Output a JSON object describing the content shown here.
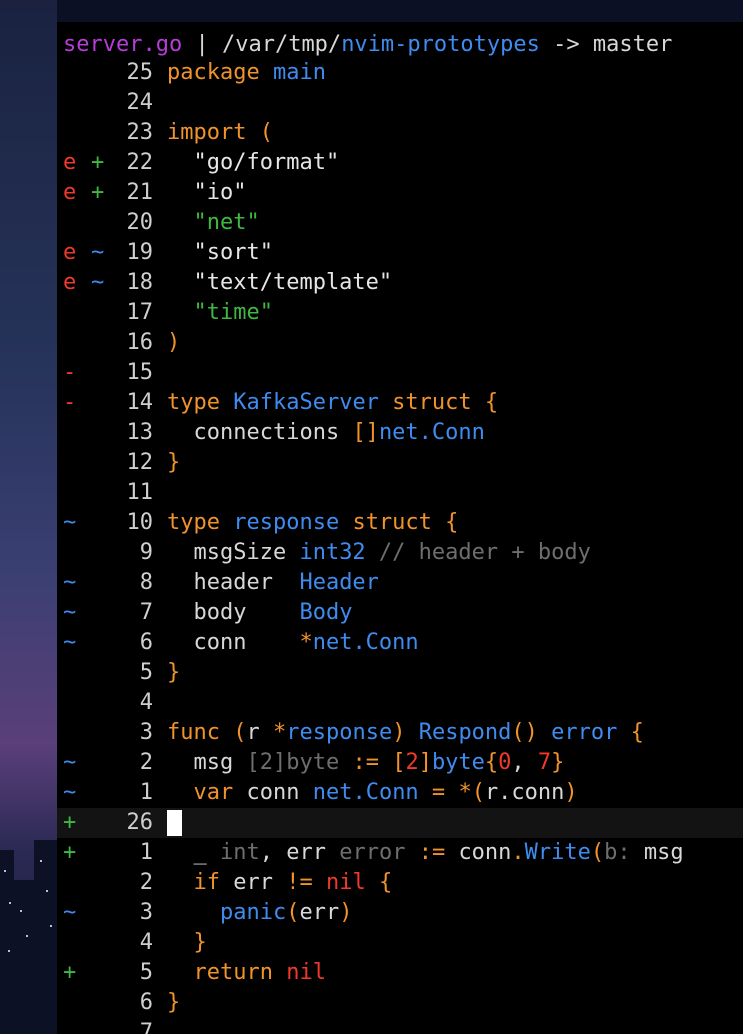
{
  "statusline": {
    "filename": "server.go",
    "separator": " | ",
    "path_prefix": "/var/tmp/",
    "path_dir": "nvim-prototypes",
    "arrow": " -> ",
    "branch": "master"
  },
  "lines": [
    {
      "sign1": "",
      "sign1_color": "",
      "sign2": "",
      "sign2_color": "",
      "lnum": "25",
      "segments": [
        {
          "text": "package ",
          "cls": "k"
        },
        {
          "text": "main",
          "cls": "t"
        }
      ]
    },
    {
      "sign1": "",
      "sign1_color": "",
      "sign2": "",
      "sign2_color": "",
      "lnum": "24",
      "segments": []
    },
    {
      "sign1": "",
      "sign1_color": "",
      "sign2": "",
      "sign2_color": "",
      "lnum": "23",
      "segments": [
        {
          "text": "import (",
          "cls": "k"
        }
      ]
    },
    {
      "sign1": "e",
      "sign1_color": "col-e",
      "sign2": "+",
      "sign2_color": "col-plus",
      "lnum": "22",
      "segments": [
        {
          "text": "  \"go/format\"",
          "cls": "s"
        }
      ]
    },
    {
      "sign1": "e",
      "sign1_color": "col-e",
      "sign2": "+",
      "sign2_color": "col-plus",
      "lnum": "21",
      "segments": [
        {
          "text": "  \"io\"",
          "cls": "s"
        }
      ]
    },
    {
      "sign1": "",
      "sign1_color": "",
      "sign2": "",
      "sign2_color": "",
      "lnum": "20",
      "segments": [
        {
          "text": "  \"net\"",
          "cls": "sg"
        }
      ]
    },
    {
      "sign1": "e",
      "sign1_color": "col-e",
      "sign2": "~",
      "sign2_color": "col-tilde",
      "lnum": "19",
      "segments": [
        {
          "text": "  \"sort\"",
          "cls": "s"
        }
      ]
    },
    {
      "sign1": "e",
      "sign1_color": "col-e",
      "sign2": "~",
      "sign2_color": "col-tilde",
      "lnum": "18",
      "segments": [
        {
          "text": "  \"text/template\"",
          "cls": "s"
        }
      ]
    },
    {
      "sign1": "",
      "sign1_color": "",
      "sign2": "",
      "sign2_color": "",
      "lnum": "17",
      "segments": [
        {
          "text": "  \"time\"",
          "cls": "sg"
        }
      ]
    },
    {
      "sign1": "",
      "sign1_color": "",
      "sign2": "",
      "sign2_color": "",
      "lnum": "16",
      "segments": [
        {
          "text": ")",
          "cls": "k"
        }
      ]
    },
    {
      "sign1": "-",
      "sign1_color": "col-minus",
      "sign2": "",
      "sign2_color": "",
      "lnum": "15",
      "segments": []
    },
    {
      "sign1": "-",
      "sign1_color": "col-minus",
      "sign2": "",
      "sign2_color": "",
      "lnum": "14",
      "segments": [
        {
          "text": "type ",
          "cls": "k"
        },
        {
          "text": "KafkaServer",
          "cls": "t"
        },
        {
          "text": " struct {",
          "cls": "k"
        }
      ]
    },
    {
      "sign1": "",
      "sign1_color": "",
      "sign2": "",
      "sign2_color": "",
      "lnum": "13",
      "segments": [
        {
          "text": "  connections ",
          "cls": "w"
        },
        {
          "text": "[]",
          "cls": "p"
        },
        {
          "text": "net.Conn",
          "cls": "t"
        }
      ]
    },
    {
      "sign1": "",
      "sign1_color": "",
      "sign2": "",
      "sign2_color": "",
      "lnum": "12",
      "segments": [
        {
          "text": "}",
          "cls": "k"
        }
      ]
    },
    {
      "sign1": "",
      "sign1_color": "",
      "sign2": "",
      "sign2_color": "",
      "lnum": "11",
      "segments": []
    },
    {
      "sign1": "~",
      "sign1_color": "col-tilde",
      "sign2": "",
      "sign2_color": "",
      "lnum": "10",
      "segments": [
        {
          "text": "type ",
          "cls": "k"
        },
        {
          "text": "response",
          "cls": "t"
        },
        {
          "text": " struct {",
          "cls": "k"
        }
      ]
    },
    {
      "sign1": "",
      "sign1_color": "",
      "sign2": "",
      "sign2_color": "",
      "lnum": "9",
      "segments": [
        {
          "text": "  msgSize ",
          "cls": "w"
        },
        {
          "text": "int32",
          "cls": "t"
        },
        {
          "text": " // header + body",
          "cls": "c"
        }
      ]
    },
    {
      "sign1": "~",
      "sign1_color": "col-tilde",
      "sign2": "",
      "sign2_color": "",
      "lnum": "8",
      "segments": [
        {
          "text": "  header  ",
          "cls": "w"
        },
        {
          "text": "Header",
          "cls": "t"
        }
      ]
    },
    {
      "sign1": "~",
      "sign1_color": "col-tilde",
      "sign2": "",
      "sign2_color": "",
      "lnum": "7",
      "segments": [
        {
          "text": "  body    ",
          "cls": "w"
        },
        {
          "text": "Body",
          "cls": "t"
        }
      ]
    },
    {
      "sign1": "~",
      "sign1_color": "col-tilde",
      "sign2": "",
      "sign2_color": "",
      "lnum": "6",
      "segments": [
        {
          "text": "  conn    ",
          "cls": "w"
        },
        {
          "text": "*",
          "cls": "p"
        },
        {
          "text": "net.Conn",
          "cls": "t"
        }
      ]
    },
    {
      "sign1": "",
      "sign1_color": "",
      "sign2": "",
      "sign2_color": "",
      "lnum": "5",
      "segments": [
        {
          "text": "}",
          "cls": "k"
        }
      ]
    },
    {
      "sign1": "",
      "sign1_color": "",
      "sign2": "",
      "sign2_color": "",
      "lnum": "4",
      "segments": []
    },
    {
      "sign1": "",
      "sign1_color": "",
      "sign2": "",
      "sign2_color": "",
      "lnum": "3",
      "segments": [
        {
          "text": "func (",
          "cls": "k"
        },
        {
          "text": "r ",
          "cls": "w"
        },
        {
          "text": "*",
          "cls": "p"
        },
        {
          "text": "response",
          "cls": "t"
        },
        {
          "text": ") ",
          "cls": "k"
        },
        {
          "text": "Respond",
          "cls": "t"
        },
        {
          "text": "() ",
          "cls": "k"
        },
        {
          "text": "error",
          "cls": "t"
        },
        {
          "text": " {",
          "cls": "k"
        }
      ]
    },
    {
      "sign1": "~",
      "sign1_color": "col-tilde",
      "sign2": "",
      "sign2_color": "",
      "lnum": "2",
      "segments": [
        {
          "text": "  msg ",
          "cls": "w"
        },
        {
          "text": "[2]byte",
          "cls": "g"
        },
        {
          "text": " := ",
          "cls": "k"
        },
        {
          "text": "[",
          "cls": "p"
        },
        {
          "text": "2",
          "cls": "n"
        },
        {
          "text": "]",
          "cls": "p"
        },
        {
          "text": "byte",
          "cls": "t"
        },
        {
          "text": "{",
          "cls": "p"
        },
        {
          "text": "0",
          "cls": "n"
        },
        {
          "text": ", ",
          "cls": "w"
        },
        {
          "text": "7",
          "cls": "n"
        },
        {
          "text": "}",
          "cls": "p"
        }
      ]
    },
    {
      "sign1": "~",
      "sign1_color": "col-tilde",
      "sign2": "",
      "sign2_color": "",
      "lnum": "1",
      "segments": [
        {
          "text": "  var ",
          "cls": "k"
        },
        {
          "text": "conn ",
          "cls": "w"
        },
        {
          "text": "net.Conn",
          "cls": "t"
        },
        {
          "text": " = ",
          "cls": "k"
        },
        {
          "text": "*",
          "cls": "p"
        },
        {
          "text": "(",
          "cls": "k"
        },
        {
          "text": "r.conn",
          "cls": "w"
        },
        {
          "text": ")",
          "cls": "k"
        }
      ]
    },
    {
      "sign1": "+",
      "sign1_color": "col-plus",
      "sign2": "",
      "sign2_color": "",
      "lnum": "26",
      "cursor": true,
      "segments": []
    },
    {
      "sign1": "+",
      "sign1_color": "col-plus",
      "sign2": "",
      "sign2_color": "",
      "lnum": "1",
      "segments": [
        {
          "text": "  _ ",
          "cls": "w"
        },
        {
          "text": "int",
          "cls": "g"
        },
        {
          "text": ", ",
          "cls": "w"
        },
        {
          "text": "err ",
          "cls": "w"
        },
        {
          "text": "error",
          "cls": "g"
        },
        {
          "text": " := ",
          "cls": "k"
        },
        {
          "text": "conn",
          "cls": "w"
        },
        {
          "text": ".",
          "cls": "k"
        },
        {
          "text": "Write",
          "cls": "t"
        },
        {
          "text": "(",
          "cls": "k"
        },
        {
          "text": "b: ",
          "cls": "g"
        },
        {
          "text": "msg",
          "cls": "w"
        }
      ]
    },
    {
      "sign1": "",
      "sign1_color": "",
      "sign2": "",
      "sign2_color": "",
      "lnum": "2",
      "segments": [
        {
          "text": "  if ",
          "cls": "k"
        },
        {
          "text": "err ",
          "cls": "w"
        },
        {
          "text": "!= ",
          "cls": "k"
        },
        {
          "text": "nil",
          "cls": "n"
        },
        {
          "text": " {",
          "cls": "k"
        }
      ]
    },
    {
      "sign1": "~",
      "sign1_color": "col-tilde",
      "sign2": "",
      "sign2_color": "",
      "lnum": "3",
      "segments": [
        {
          "text": "    ",
          "cls": "w"
        },
        {
          "text": "panic",
          "cls": "t"
        },
        {
          "text": "(",
          "cls": "k"
        },
        {
          "text": "err",
          "cls": "w"
        },
        {
          "text": ")",
          "cls": "k"
        }
      ]
    },
    {
      "sign1": "",
      "sign1_color": "",
      "sign2": "",
      "sign2_color": "",
      "lnum": "4",
      "segments": [
        {
          "text": "  }",
          "cls": "k"
        }
      ]
    },
    {
      "sign1": "+",
      "sign1_color": "col-plus",
      "sign2": "",
      "sign2_color": "",
      "lnum": "5",
      "segments": [
        {
          "text": "  return ",
          "cls": "k"
        },
        {
          "text": "nil",
          "cls": "n"
        }
      ]
    },
    {
      "sign1": "",
      "sign1_color": "",
      "sign2": "",
      "sign2_color": "",
      "lnum": "6",
      "segments": [
        {
          "text": "}",
          "cls": "k"
        }
      ]
    },
    {
      "sign1": "",
      "sign1_color": "",
      "sign2": "",
      "sign2_color": "",
      "lnum": "7",
      "segments": []
    }
  ],
  "colors": {
    "keyword": "#f0932b",
    "type": "#3f8cf0",
    "string_changed": "#e6e6e6",
    "string_unchanged": "#3fb83f",
    "comment": "#6e6e6e",
    "number": "#f0392b",
    "sign_error": "#f0392b",
    "sign_add": "#3fb83f",
    "sign_change": "#3f8cf0"
  }
}
